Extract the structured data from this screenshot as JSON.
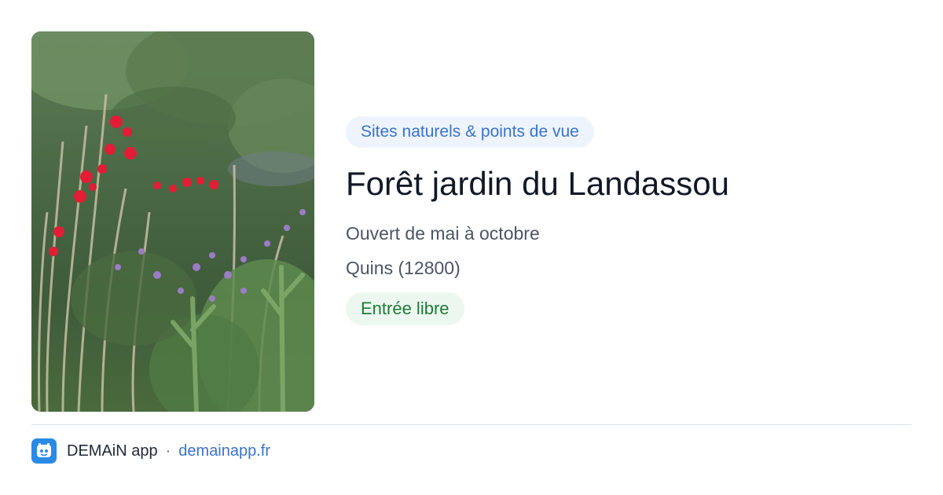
{
  "card": {
    "category": "Sites naturels & points de vue",
    "title": "Forêt jardin du Landassou",
    "hours": "Ouvert de mai à octobre",
    "location": "Quins (12800)",
    "access": "Entrée libre"
  },
  "footer": {
    "app_name": "DEMAiN app",
    "separator": "·",
    "domain": "demainapp.fr"
  },
  "colors": {
    "category_bg": "#eef4fd",
    "category_text": "#3b73c9",
    "access_bg": "#ecf8ef",
    "access_text": "#1f7a3a",
    "app_icon": "#2b8ae6"
  },
  "icons": {
    "app": "demain-app-icon"
  }
}
